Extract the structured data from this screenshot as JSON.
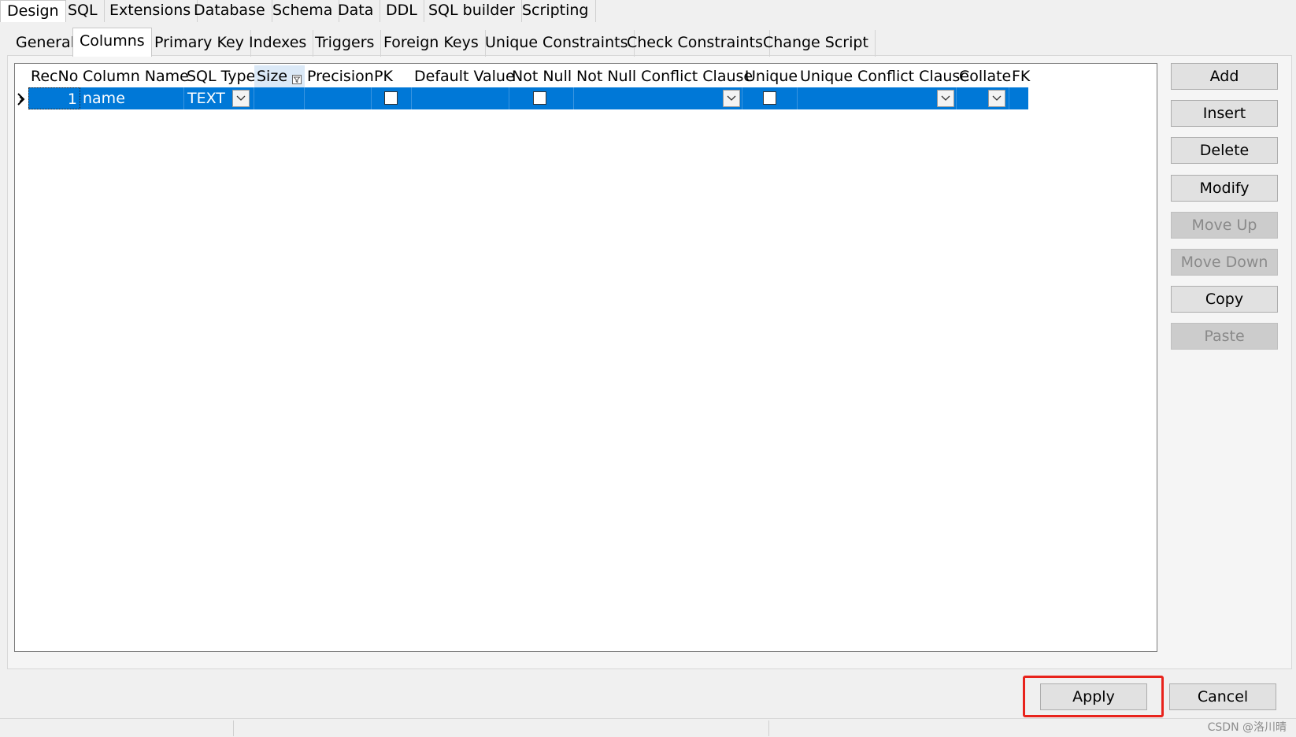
{
  "top_tabs": [
    "Design",
    "SQL",
    "Extensions",
    "Database",
    "Schema",
    "Data",
    "DDL",
    "SQL builder",
    "Scripting"
  ],
  "sub_tabs": [
    "General",
    "Columns",
    "Primary Key",
    "Indexes",
    "Triggers",
    "Foreign Keys",
    "Unique Constraints",
    "Check Constraints",
    "Change Script"
  ],
  "active_top_tab": "Design",
  "active_sub_tab": "Columns",
  "grid": {
    "headers": [
      "RecNo",
      "Column Name",
      "SQL Type",
      "Size",
      "Precision",
      "PK",
      "Default Value",
      "Not Null",
      "Not Null Conflict Clause",
      "Unique",
      "Unique Conflict Clause",
      "Collate",
      "FK"
    ],
    "row": {
      "recno": "1",
      "column_name": "name",
      "sql_type": "TEXT",
      "size": "",
      "precision": "",
      "pk": false,
      "default_value": "",
      "not_null": false,
      "not_null_conflict": "",
      "unique": false,
      "unique_conflict": "",
      "collate": "",
      "fk": ""
    },
    "selected_row_color": "#0078d7",
    "filter_icon": "filter-icon"
  },
  "side_buttons": {
    "add": "Add",
    "insert": "Insert",
    "delete": "Delete",
    "modify": "Modify",
    "move_up": "Move Up",
    "move_down": "Move Down",
    "copy": "Copy",
    "paste": "Paste"
  },
  "footer": {
    "apply": "Apply",
    "cancel": "Cancel",
    "highlight_color": "#e8231c"
  },
  "watermark": "CSDN @洛川晴"
}
